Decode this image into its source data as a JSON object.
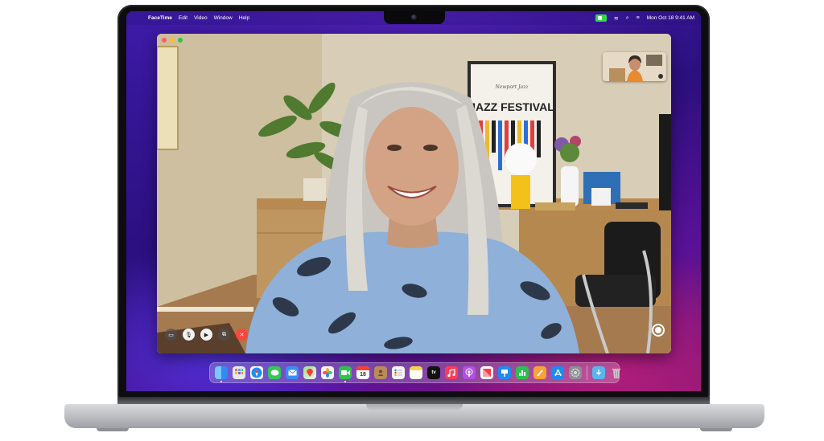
{
  "menubar": {
    "apple_glyph": "",
    "app_name": "FaceTime",
    "menus": [
      "Edit",
      "Video",
      "Window",
      "Help"
    ],
    "wifi_glyph": "≋",
    "search_glyph": "⌕",
    "control_glyph": "≡",
    "clock": "Mon Oct 18  9:41 AM"
  },
  "facetime": {
    "traffic_lights": {
      "close": "#ff5f57",
      "minimize": "#febc2e",
      "zoom": "#28c840"
    },
    "scene": {
      "poster_title": "JAZZ FESTIVAL",
      "poster_subtitle": "Newport Jazz"
    },
    "controls": {
      "sidebar_glyph": "▭",
      "mute_glyph": "🎙",
      "camera_glyph": "▶",
      "share_glyph": "⧉",
      "end_glyph": "✕"
    }
  },
  "dock": {
    "calendar_day": "18",
    "tv_label": "tv",
    "apps": [
      {
        "name": "finder-icon",
        "color": "#2f8cf6"
      },
      {
        "name": "launchpad-icon",
        "color": "#e0e0e8"
      },
      {
        "name": "safari-icon",
        "color": "#1a8dfa"
      },
      {
        "name": "messages-icon",
        "color": "#34c759"
      },
      {
        "name": "mail-icon",
        "color": "#3b8cf5"
      },
      {
        "name": "maps-icon",
        "color": "#6cc46b"
      },
      {
        "name": "photos-icon",
        "color": "#f4f4f4"
      },
      {
        "name": "facetime-icon",
        "color": "#31c24d"
      },
      {
        "name": "calendar-icon",
        "color": "#ffffff"
      },
      {
        "name": "contacts-icon",
        "color": "#b98b5a"
      },
      {
        "name": "reminders-icon",
        "color": "#f5f5f5"
      },
      {
        "name": "notes-icon",
        "color": "#f7d548"
      },
      {
        "name": "tv-icon",
        "color": "#111111"
      },
      {
        "name": "music-icon",
        "color": "#fc3c57"
      },
      {
        "name": "podcasts-icon",
        "color": "#b150e2"
      },
      {
        "name": "news-icon",
        "color": "#fb3c4a"
      },
      {
        "name": "keynote-icon",
        "color": "#1e8cf3"
      },
      {
        "name": "numbers-icon",
        "color": "#2dbe4e"
      },
      {
        "name": "pages-icon",
        "color": "#f6a33a"
      },
      {
        "name": "app-store-icon",
        "color": "#1a8cf4"
      },
      {
        "name": "system-preferences-icon",
        "color": "#8e8e93"
      }
    ],
    "trailing": [
      {
        "name": "downloads-folder-icon",
        "color": "#5ab6f0"
      },
      {
        "name": "trash-icon",
        "color": "#c7c7cc"
      }
    ]
  }
}
